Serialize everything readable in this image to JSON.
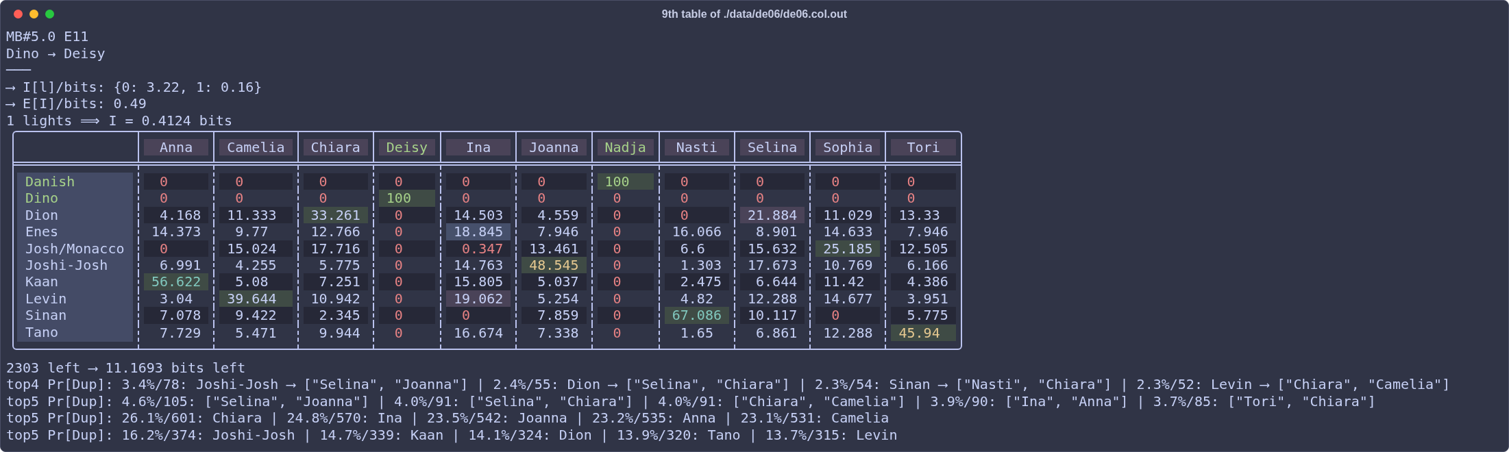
{
  "window": {
    "title": "9th table of ./data/de06/de06.col.out"
  },
  "header_lines": [
    "MB#5.0 E11",
    "Dino → Deisy",
    "───",
    "⟶ I[l]/bits: {0: 3.22, 1: 0.16}",
    "⟶ E[I]/bits: 0.49",
    "1 lights ⟹ I = 0.4124 bits"
  ],
  "table": {
    "columns": [
      {
        "label": "Anna",
        "kind": "open"
      },
      {
        "label": "Camelia",
        "kind": "open"
      },
      {
        "label": "Chiara",
        "kind": "open"
      },
      {
        "label": "Deisy",
        "kind": "matched"
      },
      {
        "label": "Ina",
        "kind": "open"
      },
      {
        "label": "Joanna",
        "kind": "open"
      },
      {
        "label": "Nadja",
        "kind": "matched"
      },
      {
        "label": "Nasti",
        "kind": "open"
      },
      {
        "label": "Selina",
        "kind": "open"
      },
      {
        "label": "Sophia",
        "kind": "open"
      },
      {
        "label": "Tori",
        "kind": "open"
      }
    ],
    "rows": [
      {
        "label": "Danish",
        "kind": "matched",
        "cells": [
          {
            "value": "0",
            "kind": "zero"
          },
          {
            "value": "0",
            "kind": "zero"
          },
          {
            "value": "0",
            "kind": "zero"
          },
          {
            "value": "0",
            "kind": "zero"
          },
          {
            "value": "0",
            "kind": "zero"
          },
          {
            "value": "0",
            "kind": "zero"
          },
          {
            "value": "100",
            "kind": "certain"
          },
          {
            "value": "0",
            "kind": "zero"
          },
          {
            "value": "0",
            "kind": "zero"
          },
          {
            "value": "0",
            "kind": "zero"
          },
          {
            "value": "0",
            "kind": "zero"
          }
        ]
      },
      {
        "label": "Dino",
        "kind": "matched",
        "cells": [
          {
            "value": "0",
            "kind": "zero"
          },
          {
            "value": "0",
            "kind": "zero"
          },
          {
            "value": "0",
            "kind": "zero"
          },
          {
            "value": "100",
            "kind": "certain"
          },
          {
            "value": "0",
            "kind": "zero"
          },
          {
            "value": "0",
            "kind": "zero"
          },
          {
            "value": "0",
            "kind": "zero"
          },
          {
            "value": "0",
            "kind": "zero"
          },
          {
            "value": "0",
            "kind": "zero"
          },
          {
            "value": "0",
            "kind": "zero"
          },
          {
            "value": "0",
            "kind": "zero"
          }
        ]
      },
      {
        "label": "Dion",
        "kind": "open",
        "cells": [
          {
            "value": "4.168",
            "kind": "plain"
          },
          {
            "value": "11.333",
            "kind": "plain"
          },
          {
            "value": "33.261",
            "kind": "match"
          },
          {
            "value": "0",
            "kind": "zero"
          },
          {
            "value": "14.503",
            "kind": "plain"
          },
          {
            "value": "4.559",
            "kind": "plain"
          },
          {
            "value": "0",
            "kind": "zero"
          },
          {
            "value": "0",
            "kind": "zero"
          },
          {
            "value": "21.884",
            "kind": "mauve"
          },
          {
            "value": "11.029",
            "kind": "plain"
          },
          {
            "value": "13.33",
            "kind": "plain"
          }
        ]
      },
      {
        "label": "Enes",
        "kind": "open",
        "cells": [
          {
            "value": "14.373",
            "kind": "plain"
          },
          {
            "value": "9.77",
            "kind": "plain"
          },
          {
            "value": "12.766",
            "kind": "plain"
          },
          {
            "value": "0",
            "kind": "zero"
          },
          {
            "value": "18.845",
            "kind": "blue"
          },
          {
            "value": "7.946",
            "kind": "plain"
          },
          {
            "value": "0",
            "kind": "zero"
          },
          {
            "value": "16.066",
            "kind": "plain"
          },
          {
            "value": "8.901",
            "kind": "plain"
          },
          {
            "value": "14.633",
            "kind": "plain"
          },
          {
            "value": "7.946",
            "kind": "plain"
          }
        ]
      },
      {
        "label": "Josh/Monacco",
        "kind": "open",
        "cells": [
          {
            "value": "0",
            "kind": "zero"
          },
          {
            "value": "15.024",
            "kind": "plain"
          },
          {
            "value": "17.716",
            "kind": "plain"
          },
          {
            "value": "0",
            "kind": "zero"
          },
          {
            "value": "0.347",
            "kind": "zero"
          },
          {
            "value": "13.461",
            "kind": "plain"
          },
          {
            "value": "0",
            "kind": "zero"
          },
          {
            "value": "6.6",
            "kind": "plain"
          },
          {
            "value": "15.632",
            "kind": "plain"
          },
          {
            "value": "25.185",
            "kind": "match"
          },
          {
            "value": "12.505",
            "kind": "plain"
          }
        ]
      },
      {
        "label": "Joshi-Josh",
        "kind": "open",
        "cells": [
          {
            "value": "6.991",
            "kind": "plain"
          },
          {
            "value": "4.255",
            "kind": "plain"
          },
          {
            "value": "5.775",
            "kind": "plain"
          },
          {
            "value": "0",
            "kind": "zero"
          },
          {
            "value": "14.763",
            "kind": "plain"
          },
          {
            "value": "48.545",
            "kind": "warm"
          },
          {
            "value": "0",
            "kind": "zero"
          },
          {
            "value": "1.303",
            "kind": "plain"
          },
          {
            "value": "17.673",
            "kind": "plain"
          },
          {
            "value": "10.769",
            "kind": "plain"
          },
          {
            "value": "6.166",
            "kind": "plain"
          }
        ]
      },
      {
        "label": "Kaan",
        "kind": "open",
        "cells": [
          {
            "value": "56.622",
            "kind": "strong"
          },
          {
            "value": "5.08",
            "kind": "plain"
          },
          {
            "value": "7.251",
            "kind": "plain"
          },
          {
            "value": "0",
            "kind": "zero"
          },
          {
            "value": "15.805",
            "kind": "plain"
          },
          {
            "value": "5.037",
            "kind": "plain"
          },
          {
            "value": "0",
            "kind": "zero"
          },
          {
            "value": "2.475",
            "kind": "plain"
          },
          {
            "value": "6.644",
            "kind": "plain"
          },
          {
            "value": "11.42",
            "kind": "plain"
          },
          {
            "value": "4.386",
            "kind": "plain"
          }
        ]
      },
      {
        "label": "Levin",
        "kind": "open",
        "cells": [
          {
            "value": "3.04",
            "kind": "plain"
          },
          {
            "value": "39.644",
            "kind": "match"
          },
          {
            "value": "10.942",
            "kind": "plain"
          },
          {
            "value": "0",
            "kind": "zero"
          },
          {
            "value": "19.062",
            "kind": "mauve"
          },
          {
            "value": "5.254",
            "kind": "plain"
          },
          {
            "value": "0",
            "kind": "zero"
          },
          {
            "value": "4.82",
            "kind": "plain"
          },
          {
            "value": "12.288",
            "kind": "plain"
          },
          {
            "value": "14.677",
            "kind": "plain"
          },
          {
            "value": "3.951",
            "kind": "plain"
          }
        ]
      },
      {
        "label": "Sinan",
        "kind": "open",
        "cells": [
          {
            "value": "7.078",
            "kind": "plain"
          },
          {
            "value": "9.422",
            "kind": "plain"
          },
          {
            "value": "2.345",
            "kind": "plain"
          },
          {
            "value": "0",
            "kind": "zero"
          },
          {
            "value": "0",
            "kind": "zero"
          },
          {
            "value": "7.859",
            "kind": "plain"
          },
          {
            "value": "0",
            "kind": "zero"
          },
          {
            "value": "67.086",
            "kind": "strong"
          },
          {
            "value": "10.117",
            "kind": "plain"
          },
          {
            "value": "0",
            "kind": "zero"
          },
          {
            "value": "5.775",
            "kind": "plain"
          }
        ]
      },
      {
        "label": "Tano",
        "kind": "open",
        "cells": [
          {
            "value": "7.729",
            "kind": "plain"
          },
          {
            "value": "5.471",
            "kind": "plain"
          },
          {
            "value": "9.944",
            "kind": "plain"
          },
          {
            "value": "0",
            "kind": "zero"
          },
          {
            "value": "16.674",
            "kind": "plain"
          },
          {
            "value": "7.338",
            "kind": "plain"
          },
          {
            "value": "0",
            "kind": "zero"
          },
          {
            "value": "1.65",
            "kind": "plain"
          },
          {
            "value": "6.861",
            "kind": "plain"
          },
          {
            "value": "12.288",
            "kind": "plain"
          },
          {
            "value": "45.94",
            "kind": "warm"
          }
        ]
      }
    ]
  },
  "footer_lines": [
    "2303 left ⟶ 11.1693 bits left",
    "top4 Pr[Dup]: 3.4%/78: Joshi-Josh ⟶ [\"Selina\", \"Joanna\"] | 2.4%/55: Dion ⟶ [\"Selina\", \"Chiara\"] | 2.3%/54: Sinan ⟶ [\"Nasti\", \"Chiara\"] | 2.3%/52: Levin ⟶ [\"Chiara\", \"Camelia\"]",
    "top5 Pr[Dup]: 4.6%/105: [\"Selina\", \"Joanna\"] | 4.0%/91: [\"Selina\", \"Chiara\"] | 4.0%/91: [\"Chiara\", \"Camelia\"] | 3.9%/90: [\"Ina\", \"Anna\"] | 3.7%/85: [\"Tori\", \"Chiara\"]",
    "top5 Pr[Dup]: 26.1%/601: Chiara | 24.8%/570: Ina | 23.5%/542: Joanna | 23.2%/535: Anna | 23.1%/531: Camelia",
    "top5 Pr[Dup]: 16.2%/374: Joshi-Josh | 14.7%/339: Kaan | 14.1%/324: Dion | 13.9%/320: Tano | 13.7%/315: Levin"
  ]
}
